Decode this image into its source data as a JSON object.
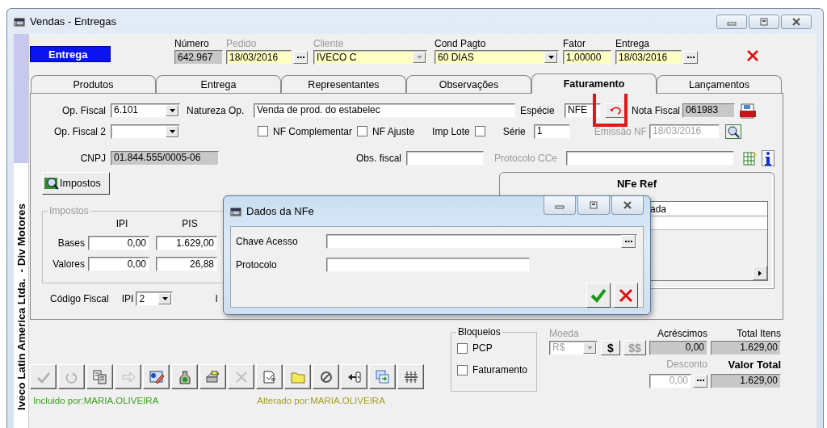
{
  "window": {
    "title": "Vendas - Entregas"
  },
  "side_label": "Iveco Latin America Ltda.  - Div Motores",
  "mode_badge": "Entrega",
  "header_fields": [
    {
      "label": "Número",
      "value": "642.967",
      "kind": "readonly",
      "disabled": false
    },
    {
      "label": "Pedido",
      "value": "18/03/2016",
      "kind": "date",
      "disabled": true
    },
    {
      "label": "Cliente",
      "value": "IVECO  C",
      "kind": "combo",
      "disabled": true
    },
    {
      "label": "Cond Pagto",
      "value": "60 DIAS",
      "kind": "combo",
      "disabled": false
    },
    {
      "label": "Fator",
      "value": "1,00000",
      "kind": "text",
      "disabled": false
    },
    {
      "label": "Entrega",
      "value": "18/03/2016",
      "kind": "date",
      "disabled": false
    }
  ],
  "tabs": [
    {
      "label": "Produtos",
      "selected": false
    },
    {
      "label": "Entrega",
      "selected": false
    },
    {
      "label": "Representantes",
      "selected": false
    },
    {
      "label": "Observações",
      "selected": false
    },
    {
      "label": "Faturamento",
      "selected": true
    },
    {
      "label": "Lançamentos",
      "selected": false
    }
  ],
  "faturamento": {
    "op_fiscal": {
      "label": "Op. Fiscal",
      "value": "6.101"
    },
    "natureza_op": {
      "label": "Natureza Op.",
      "value": "Venda de prod. do estabelec"
    },
    "especie": {
      "label": "Espécie",
      "value": "NFE"
    },
    "nota_fiscal": {
      "label": "Nota Fiscal",
      "value": "061983"
    },
    "op_fiscal_2": {
      "label": "Op. Fiscal 2"
    },
    "checks": [
      {
        "label": "NF Complementar",
        "checked": false
      },
      {
        "label": "NF Ajuste",
        "checked": false
      }
    ],
    "imp_lote": {
      "label": "Imp Lote",
      "checked": false
    },
    "serie": {
      "label": "Série",
      "value": "1"
    },
    "emissao_nf": {
      "label": "Emissão NF",
      "value": "18/03/2016",
      "disabled": true
    },
    "cnpj": {
      "label": "CNPJ",
      "value": "01.844.555/0005-06"
    },
    "obs_fiscal": {
      "label": "Obs. fiscal"
    },
    "protocolo_cce": {
      "label": "Protocolo CCe",
      "disabled": true
    },
    "impostos_button": "Impostos",
    "impostos": {
      "legend": "Impostos",
      "columns": [
        "IPI",
        "PIS"
      ],
      "rows": [
        {
          "label": "Bases",
          "values": [
            "0,00",
            "1.629,00"
          ]
        },
        {
          "label": "Valores",
          "values": [
            "0,00",
            "26,88"
          ]
        }
      ]
    },
    "codigo_fiscal": {
      "label": "Código Fiscal",
      "ipi_label": "IPI",
      "ipi_value": "2",
      "column_3_label": "I"
    },
    "nfe_ref": {
      "title": "NFe Ref",
      "columns": [
        "ada"
      ]
    }
  },
  "dialog": {
    "title": "Dados da NFe",
    "fields": [
      {
        "label": "Chave Acesso",
        "kind": "lookup"
      },
      {
        "label": "Protocolo",
        "kind": "text"
      }
    ]
  },
  "toolbar": [
    {
      "kind": "check",
      "disabled": true
    },
    {
      "kind": "refresh",
      "disabled": true
    },
    {
      "kind": "documents",
      "disabled": false
    },
    {
      "kind": "arrow",
      "disabled": true
    },
    {
      "kind": "edit",
      "disabled": false
    },
    {
      "kind": "bag",
      "disabled": false
    },
    {
      "kind": "printer",
      "disabled": false
    },
    {
      "kind": "cross",
      "disabled": true
    },
    {
      "kind": "document",
      "disabled": false
    },
    {
      "kind": "folder",
      "disabled": false
    },
    {
      "kind": "prohibited",
      "disabled": false
    },
    {
      "kind": "exit",
      "disabled": false
    },
    {
      "kind": "windows",
      "disabled": false
    },
    {
      "kind": "arrows",
      "disabled": false
    }
  ],
  "status": {
    "created_by": "Incluido por:MARIA.OLIVEIRA",
    "altered_by": "Alterado por:MARIA.OLIVEIRA"
  },
  "bloqueios": {
    "legend": "Bloqueios",
    "items": [
      {
        "label": "PCP",
        "checked": false
      },
      {
        "label": "Faturamento",
        "checked": false
      }
    ]
  },
  "totals": {
    "moeda": {
      "label": "Moeda",
      "value": "R$",
      "disabled": true
    },
    "currency_buttons": [
      {
        "label": "$",
        "disabled": false
      },
      {
        "label": "$$",
        "disabled": true
      }
    ],
    "acrescimos": {
      "label": "Acréscimos",
      "value": "0,00"
    },
    "total_itens": {
      "label": "Total Itens",
      "value": "1.629,00"
    },
    "desconto": {
      "label": "Desconto",
      "value": "0,00",
      "disabled": true
    },
    "valor_total": {
      "label": "Valor Total",
      "value": "1.629,00"
    }
  }
}
